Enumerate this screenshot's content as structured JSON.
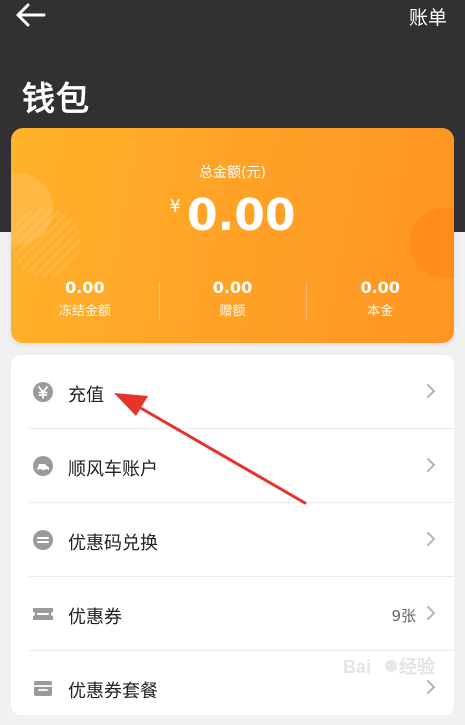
{
  "header": {
    "bill_label": "账单",
    "title": "钱包"
  },
  "balance_card": {
    "total_label": "总金额(元)",
    "currency_symbol": "¥",
    "total_amount": "0.00",
    "stats": [
      {
        "value": "0.00",
        "label": "冻结金额"
      },
      {
        "value": "0.00",
        "label": "赠额"
      },
      {
        "value": "0.00",
        "label": "本金"
      }
    ]
  },
  "menu": {
    "items": [
      {
        "label": "充值",
        "icon": "yuan-coin-icon"
      },
      {
        "label": "顺风车账户",
        "icon": "car-account-icon"
      },
      {
        "label": "优惠码兑换",
        "icon": "code-exchange-icon"
      },
      {
        "label": "优惠券",
        "icon": "coupon-ticket-icon",
        "extra": "9张"
      },
      {
        "label": "优惠券套餐",
        "icon": "coupon-package-icon"
      }
    ]
  },
  "colors": {
    "header_bg": "#313133",
    "card_gradient_start": "#ffb22a",
    "card_gradient_end": "#ff9422",
    "icon_gray": "#9a9a9c",
    "annotation_red": "#e8322b"
  }
}
